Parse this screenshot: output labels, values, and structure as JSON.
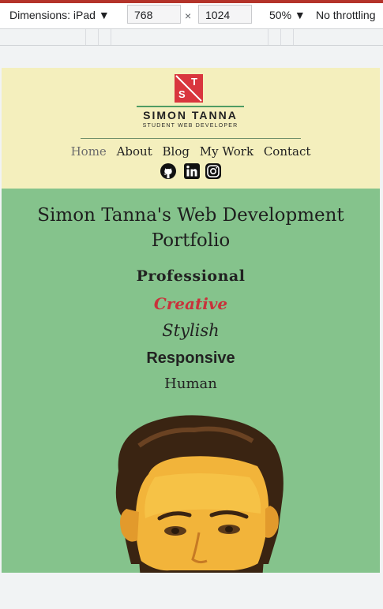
{
  "devtools": {
    "dimensions_label": "Dimensions: iPad ▼",
    "width": "768",
    "times": "×",
    "height": "1024",
    "zoom": "50% ▼",
    "throttling": "No throttling"
  },
  "site": {
    "logo": {
      "letter_top": "T",
      "letter_bottom": "S",
      "name": "SIMON TANNA",
      "tagline": "STUDENT WEB DEVELOPER"
    },
    "nav": [
      {
        "label": "Home",
        "active": true
      },
      {
        "label": "About"
      },
      {
        "label": "Blog"
      },
      {
        "label": "My Work"
      },
      {
        "label": "Contact"
      }
    ],
    "social_icons": [
      "github-icon",
      "linkedin-icon",
      "instagram-icon"
    ],
    "hero": {
      "title": "Simon Tanna's Web Development Portfolio",
      "words": [
        "Professional",
        "Creative",
        "Stylish",
        "Responsive",
        "Human"
      ]
    }
  },
  "colors": {
    "header_bg": "#f4efbd",
    "hero_bg": "#85c38c",
    "accent_red": "#d9363e",
    "accent_green": "#4f9c63"
  }
}
